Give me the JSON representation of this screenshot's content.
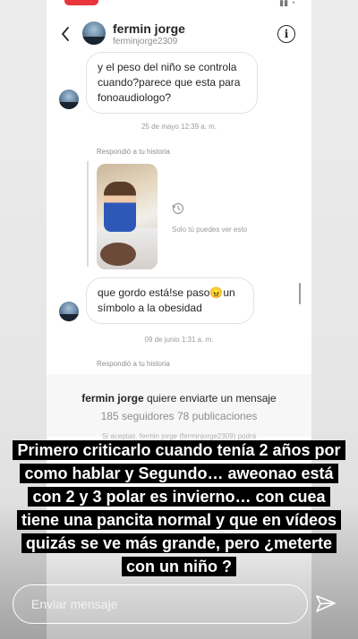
{
  "header": {
    "name": "fermin jorge",
    "handle": "ferminjorge2309"
  },
  "messages": {
    "first": "y el peso del niño se controla cuando?parece que esta para fonoaudiologo?",
    "timestamp_1": "25 de mayo 12:39 a. m.",
    "replied_1": "Respondió a tu historia",
    "only_you": "Solo tú puedes ver esto",
    "second": "que gordo está!se paso😠un símbolo a la obesidad",
    "timestamp_2": "09 de junio 1:31 a. m.",
    "replied_2": "Respondió a tu historia"
  },
  "request": {
    "name": "fermin jorge",
    "text": " quiere enviarte un mensaje",
    "stats": "185 seguidores 78 publicaciones",
    "hidden_note": "Si aceptas, fermin jorge (ferminjorge2309) podrá"
  },
  "caption": {
    "text": "Primero criticarlo cuando tenía 2 años por como hablar y Segundo… aweonao está con 2 y 3 polar es invierno… con cuea tiene una pancita normal y que en vídeos quizás se ve más grande, pero ¿meterte con un niño ?"
  },
  "composer": {
    "placeholder": "Enviar mensaje"
  },
  "icons": {
    "back": "chevron-left-icon",
    "info": "info-icon",
    "history": "history-icon",
    "send": "send-icon"
  },
  "colors": {
    "status_pill": "#e8343b",
    "caption_bg": "#000000",
    "caption_text": "#ffffff"
  }
}
